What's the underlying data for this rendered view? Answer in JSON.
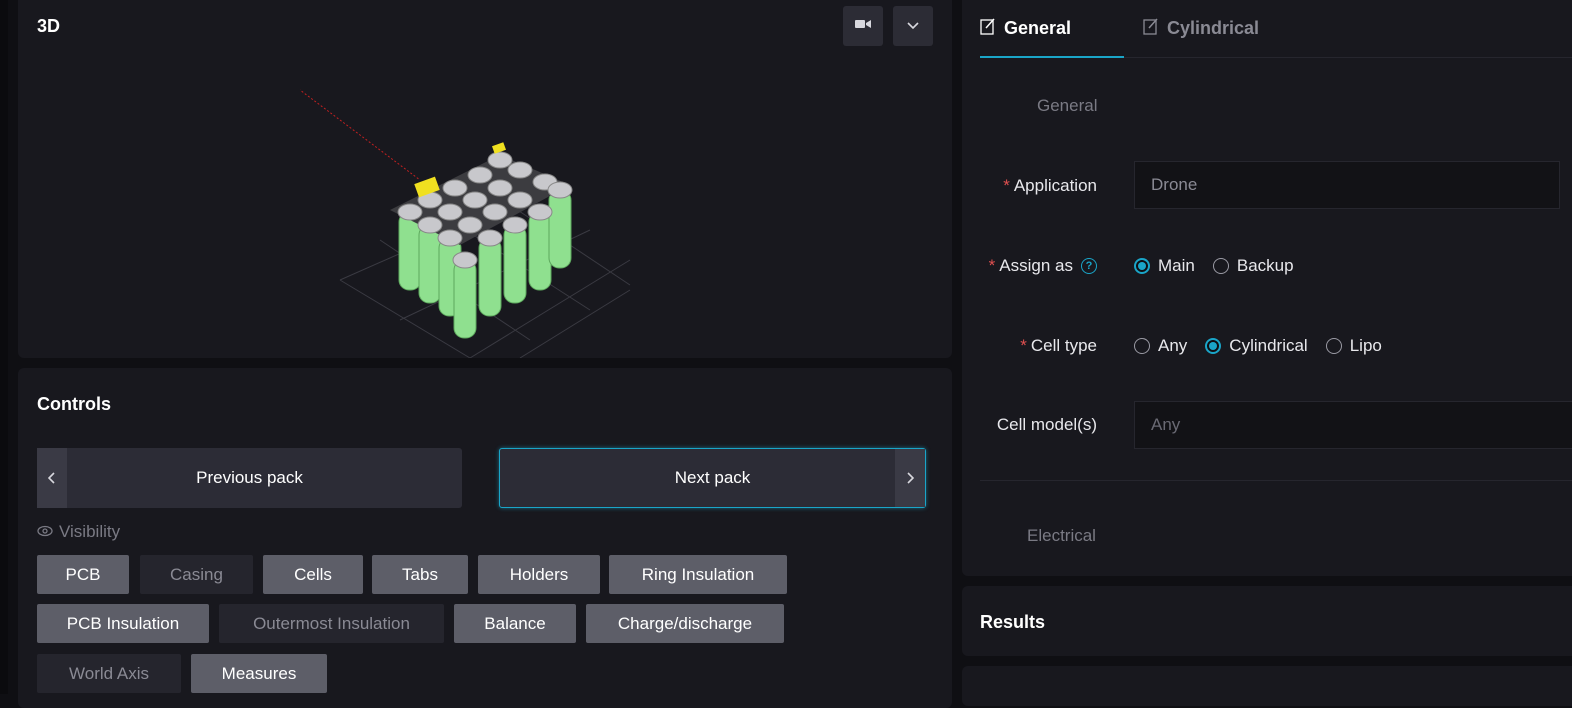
{
  "viewer": {
    "title": "3D",
    "camera_icon": "video-camera-icon",
    "dropdown_icon": "chevron-down-icon"
  },
  "controls": {
    "title": "Controls",
    "prev_label": "Previous pack",
    "next_label": "Next pack",
    "visibility_label": "Visibility",
    "toggles": [
      {
        "label": "PCB",
        "on": true
      },
      {
        "label": "Casing",
        "on": false
      },
      {
        "label": "Cells",
        "on": true
      },
      {
        "label": "Tabs",
        "on": true
      },
      {
        "label": "Holders",
        "on": true
      },
      {
        "label": "Ring Insulation",
        "on": true
      },
      {
        "label": "PCB Insulation",
        "on": true
      },
      {
        "label": "Outermost Insulation",
        "on": false
      },
      {
        "label": "Balance",
        "on": true
      },
      {
        "label": "Charge/discharge",
        "on": true
      },
      {
        "label": "World Axis",
        "on": false
      },
      {
        "label": "Measures",
        "on": true
      }
    ]
  },
  "tabs": [
    {
      "label": "General",
      "active": true
    },
    {
      "label": "Cylindrical",
      "active": false
    }
  ],
  "form": {
    "section_general": "General",
    "application": {
      "label": "Application",
      "value": "Drone"
    },
    "assign_as": {
      "label": "Assign as",
      "options": [
        "Main",
        "Backup"
      ],
      "selected": "Main"
    },
    "cell_type": {
      "label": "Cell type",
      "options": [
        "Any",
        "Cylindrical",
        "Lipo"
      ],
      "selected": "Cylindrical"
    },
    "cell_models": {
      "label": "Cell model(s)",
      "placeholder": "Any"
    },
    "section_electrical": "Electrical",
    "required_mark": "*"
  },
  "results": {
    "title": "Results"
  },
  "colors": {
    "accent": "#1aa5c8",
    "required": "#e05050",
    "cell_green": "#8fe08f",
    "tab_yellow": "#f0e020"
  }
}
